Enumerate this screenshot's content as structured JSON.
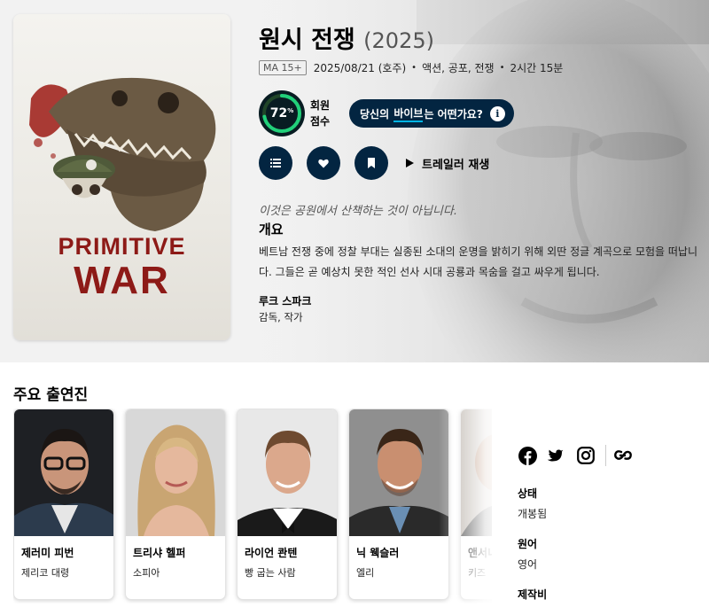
{
  "movie": {
    "title": "원시 전쟁",
    "year": "(2025)",
    "certification": "MA 15+",
    "release": "2025/08/21 (호주)",
    "genres": "액션, 공포, 전쟁",
    "runtime": "2시간 15분",
    "tagline": "이것은 공원에서 산책하는 것이 아닙니다.",
    "overview_heading": "개요",
    "overview": "베트남 전쟁 중에 정찰 부대는 실종된 소대의 운명을 밝히기 위해 외딴 정글 계곡으로 모험을 떠납니다. 그들은 곧 예상치 못한 적인 선사 시대 공룡과 목숨을 걸고 싸우게 됩니다."
  },
  "poster": {
    "line1": "PRIMITIVE",
    "line2": "WAR"
  },
  "score": {
    "value": 72,
    "value_text": "72",
    "percent_sign": "%",
    "label_line1": "회원",
    "label_line2": "점수",
    "ring_color": "#21d07a",
    "track_color": "#204529"
  },
  "vibe": {
    "prefix": "당신의",
    "highlight": "바이브",
    "suffix": "는 어떤가요?",
    "info_icon": "i"
  },
  "actions": {
    "list_icon": "list-icon",
    "favorite_icon": "heart-icon",
    "watchlist_icon": "bookmark-icon",
    "trailer_label": "트레일러 재생"
  },
  "crew": [
    {
      "name": "루크 스파크",
      "role": "감독, 작가"
    }
  ],
  "cast_heading": "주요 출연진",
  "cast": [
    {
      "name": "제러미 피번",
      "role": "제리코 대령"
    },
    {
      "name": "트리샤 헬퍼",
      "role": "소피아"
    },
    {
      "name": "라이언 콴텐",
      "role": "빵 굽는 사람"
    },
    {
      "name": "닉 웩슬러",
      "role": "엘리"
    },
    {
      "name": "앤서니",
      "role": "키즈"
    }
  ],
  "social": [
    "facebook-icon",
    "twitter-icon",
    "instagram-icon",
    "justwatch-link-icon"
  ],
  "side_facts": [
    {
      "label": "상태",
      "value": "개봉됨"
    },
    {
      "label": "원어",
      "value": "영어"
    },
    {
      "label": "제작비",
      "value": ""
    }
  ],
  "colors": {
    "navy": "#032541",
    "accent": "#01b4e4",
    "poster_red": "#8d1a17"
  }
}
